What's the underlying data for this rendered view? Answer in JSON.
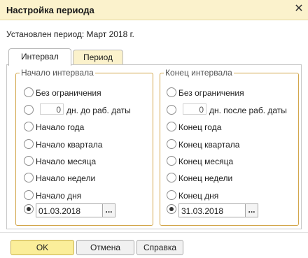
{
  "window": {
    "title": "Настройка периода",
    "close_glyph": "✕"
  },
  "status_text": "Установлен период: Март 2018 г.",
  "tabs": [
    {
      "label": "Интервал",
      "active": true
    },
    {
      "label": "Период",
      "active": false
    }
  ],
  "start": {
    "legend": "Начало интервала",
    "options": [
      {
        "label": "Без ограничения",
        "selected": false
      },
      {
        "label": "дн. до раб. даты",
        "value": "0",
        "selected": false
      },
      {
        "label": "Начало года",
        "selected": false
      },
      {
        "label": "Начало квартала",
        "selected": false
      },
      {
        "label": "Начало месяца",
        "selected": false
      },
      {
        "label": "Начало недели",
        "selected": false
      },
      {
        "label": "Начало дня",
        "selected": false
      }
    ],
    "date_value": "01.03.2018",
    "date_selected": true
  },
  "end": {
    "legend": "Конец интервала",
    "options": [
      {
        "label": "Без ограничения",
        "selected": false
      },
      {
        "label": "дн. после раб. даты",
        "value": "0",
        "selected": false
      },
      {
        "label": "Конец года",
        "selected": false
      },
      {
        "label": "Конец квартала",
        "selected": false
      },
      {
        "label": "Конец месяца",
        "selected": false
      },
      {
        "label": "Конец недели",
        "selected": false
      },
      {
        "label": "Конец дня",
        "selected": false
      }
    ],
    "date_value": "31.03.2018",
    "date_selected": true
  },
  "picker_glyph": "...",
  "buttons": {
    "ok": "OK",
    "cancel": "Отмена",
    "help": "Справка"
  },
  "colors": {
    "titlebar": "#fbf2cc",
    "group_border": "#d2a64b",
    "ok_button": "#fbee9a"
  }
}
